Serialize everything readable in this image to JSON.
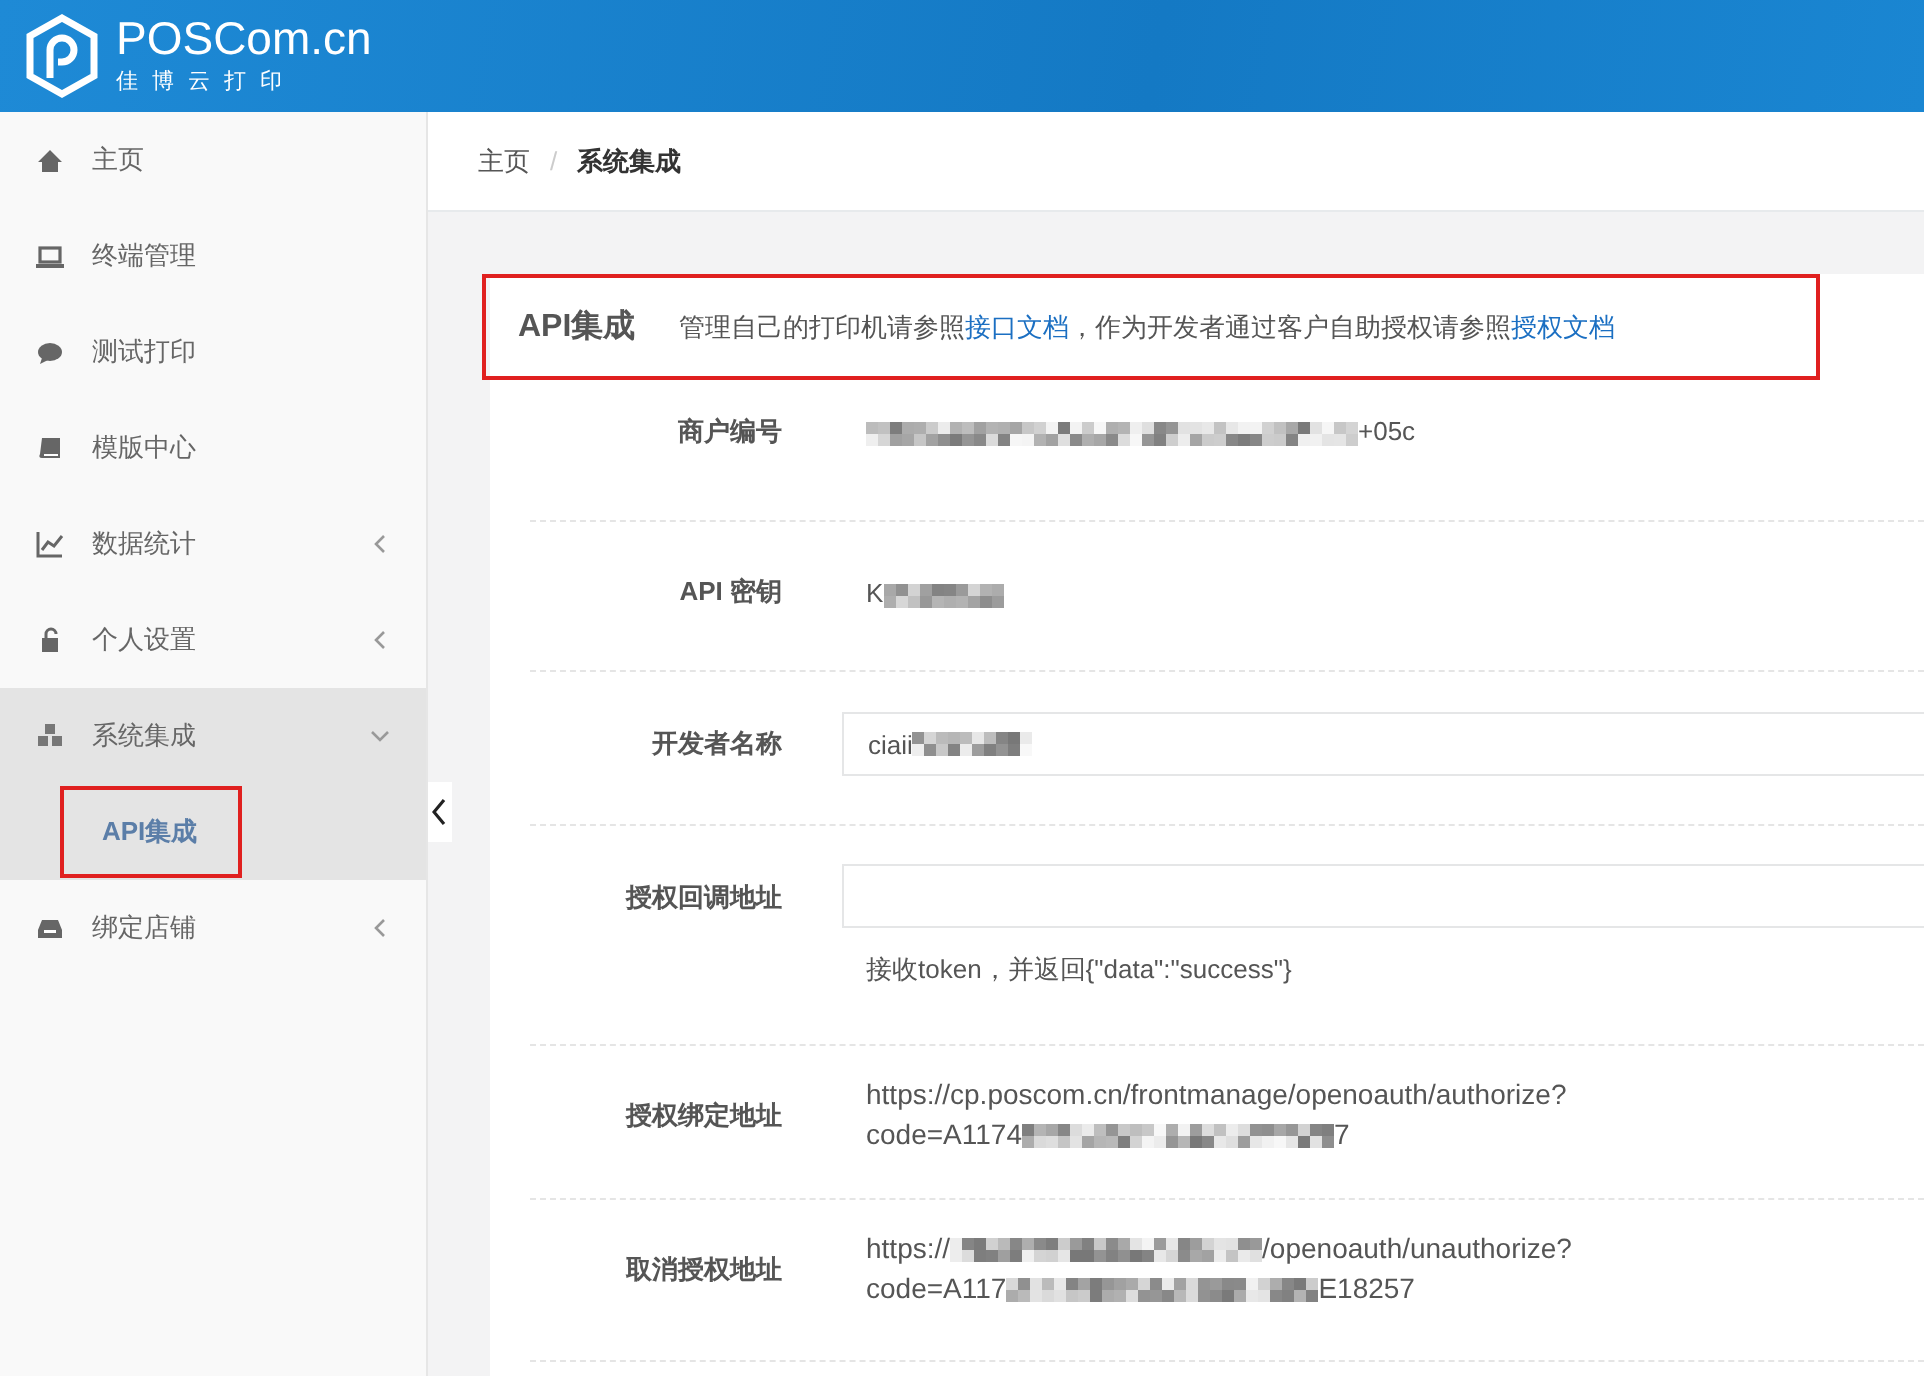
{
  "header": {
    "logo_title": "POSCom.cn",
    "logo_subtitle": "佳 博 云 打 印"
  },
  "sidebar": {
    "items": [
      {
        "label": "主页",
        "kind": "link",
        "selected": false
      },
      {
        "label": "终端管理",
        "kind": "link",
        "selected": false
      },
      {
        "label": "测试打印",
        "kind": "link",
        "selected": false
      },
      {
        "label": "模版中心",
        "kind": "link",
        "selected": false
      },
      {
        "label": "数据统计",
        "kind": "submenu",
        "expanded": false,
        "selected": false
      },
      {
        "label": "个人设置",
        "kind": "submenu",
        "expanded": false,
        "selected": false
      },
      {
        "label": "系统集成",
        "kind": "submenu",
        "expanded": true,
        "selected": true,
        "children": [
          {
            "label": "API集成",
            "selected": true,
            "highlighted": true
          }
        ]
      },
      {
        "label": "绑定店铺",
        "kind": "submenu",
        "expanded": false,
        "selected": false
      }
    ]
  },
  "breadcrumb": [
    {
      "label": "主页"
    },
    {
      "label": "系统集成"
    }
  ],
  "breadcrumb_separator": "/",
  "card": {
    "title": "API集成",
    "highlighted": true,
    "description": [
      {
        "kind": "text",
        "text": "管理自己的打印机请参照"
      },
      {
        "kind": "link",
        "text": "接口文档"
      },
      {
        "kind": "text",
        "text": "，作为开发者通过客户自助授权请参照"
      },
      {
        "kind": "link",
        "text": "授权文档"
      }
    ],
    "fields": [
      {
        "label": "商户编号",
        "kind": "static",
        "value": [
          {
            "kind": "mosaic"
          },
          {
            "kind": "text",
            "text": "+05c"
          }
        ]
      },
      {
        "label": "API 密钥",
        "kind": "static",
        "value": [
          {
            "kind": "text",
            "text": "K"
          },
          {
            "kind": "mosaic"
          }
        ]
      },
      {
        "label": "开发者名称",
        "kind": "input",
        "value": [
          {
            "kind": "text",
            "text": "ciaii"
          },
          {
            "kind": "mosaic"
          }
        ]
      },
      {
        "label": "授权回调地址",
        "kind": "input",
        "help": "接收token，并返回{\"data\":\"success\"}"
      },
      {
        "label": "授权绑定地址",
        "kind": "static",
        "lines": [
          [
            {
              "kind": "text",
              "text": "https://cp.poscom.cn/frontmanage/openoauth/authorize?"
            }
          ],
          [
            {
              "kind": "text",
              "text": "code=A1174"
            },
            {
              "kind": "mosaic"
            },
            {
              "kind": "text",
              "text": "7"
            }
          ]
        ]
      },
      {
        "label": "取消授权地址",
        "kind": "static",
        "lines": [
          [
            {
              "kind": "text",
              "text": "https://"
            },
            {
              "kind": "mosaic"
            },
            {
              "kind": "text",
              "text": "/openoauth/unauthorize?"
            }
          ],
          [
            {
              "kind": "text",
              "text": "code=A117"
            },
            {
              "kind": "mosaic"
            },
            {
              "kind": "text",
              "text": "E18257"
            }
          ]
        ]
      }
    ]
  }
}
